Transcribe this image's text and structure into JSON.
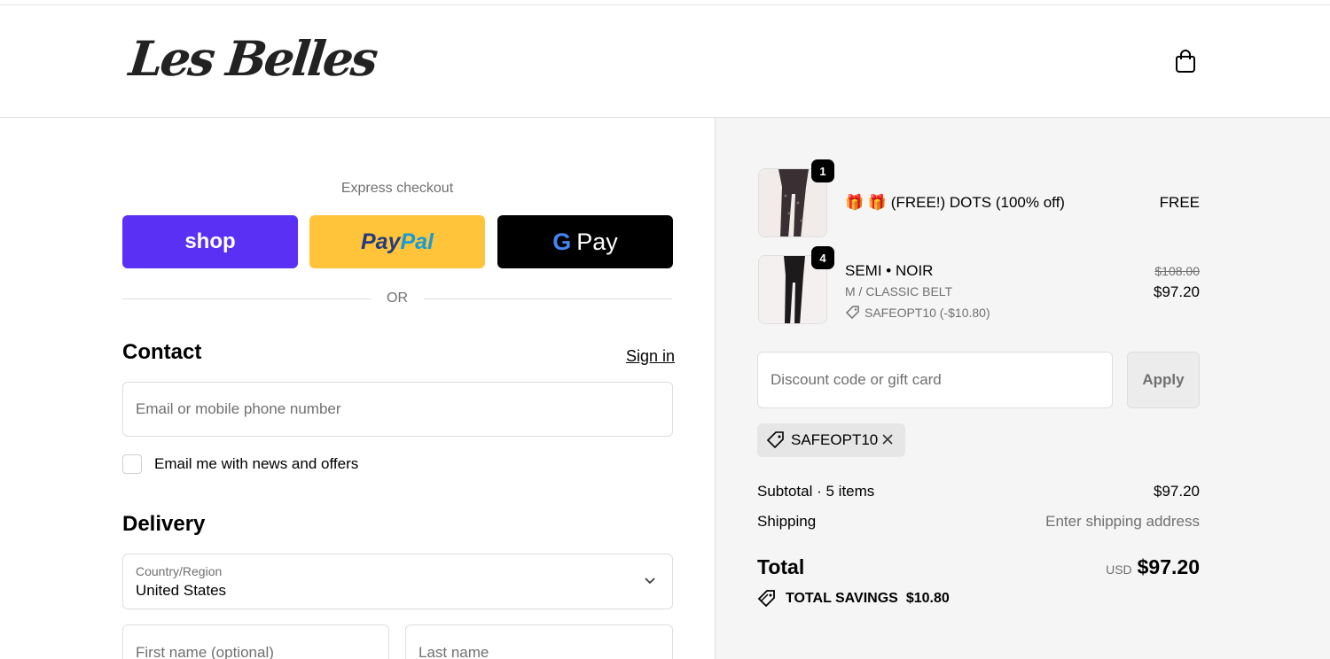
{
  "header": {
    "logo_text": "Les Belles",
    "cart_icon": "shopping-bag-icon"
  },
  "express": {
    "title": "Express checkout",
    "shop_label": "shop",
    "paypal_label_1": "Pay",
    "paypal_label_2": "Pal",
    "gpay_g": "G",
    "gpay_label": "Pay",
    "or_label": "OR"
  },
  "contact": {
    "title": "Contact",
    "signin_label": "Sign in",
    "email_placeholder": "Email or mobile phone number",
    "news_label": "Email me with news and offers"
  },
  "delivery": {
    "title": "Delivery",
    "country_label": "Country/Region",
    "country_value": "United States",
    "first_name_placeholder": "First name (optional)",
    "last_name_placeholder": "Last name"
  },
  "order": {
    "items": [
      {
        "qty": "1",
        "name": "🎁 🎁 (FREE!) DOTS (100% off)",
        "price": "FREE"
      },
      {
        "qty": "4",
        "name": "SEMI • NOIR",
        "variant": "M / CLASSIC BELT",
        "discount": "SAFEOPT10 (-$10.80)",
        "original_price": "$108.00",
        "price": "$97.20"
      }
    ],
    "discount_placeholder": "Discount code or gift card",
    "apply_label": "Apply",
    "applied_code": "SAFEOPT10",
    "subtotal_label": "Subtotal · 5 items",
    "subtotal_value": "$97.20",
    "shipping_label": "Shipping",
    "shipping_value": "Enter shipping address",
    "total_label": "Total",
    "total_currency": "USD",
    "total_value": "$97.20",
    "savings_label": "TOTAL SAVINGS",
    "savings_value": "$10.80"
  },
  "colors": {
    "shop_purple": "#5a31f4",
    "paypal_yellow": "#ffc439",
    "gpay_black": "#000000",
    "panel_gray": "#f5f5f5"
  }
}
